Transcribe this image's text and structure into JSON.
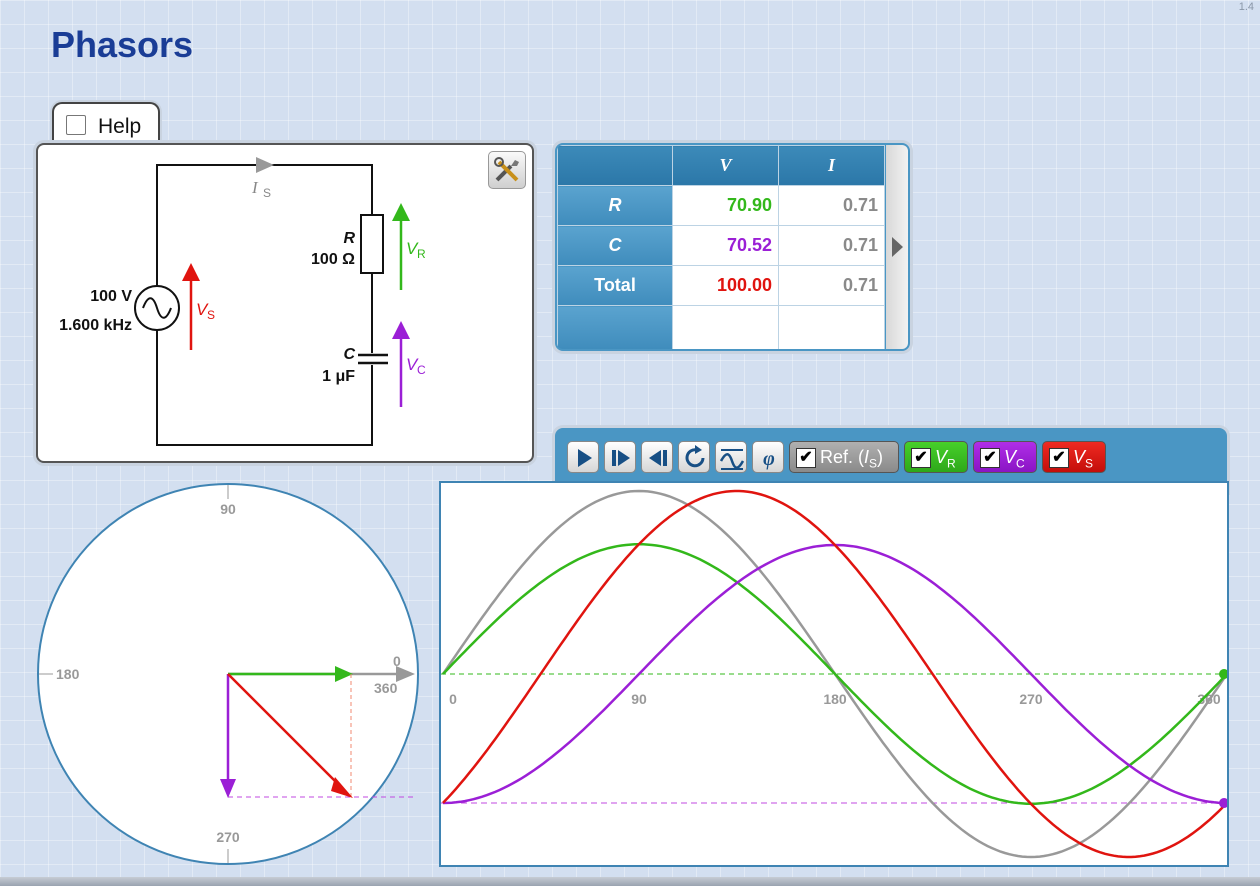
{
  "version": "1.4",
  "title": "Phasors",
  "help": {
    "label": "Help"
  },
  "circuit": {
    "source_voltage": "100 V",
    "source_frequency": "1.600 kHz",
    "current_label": "I",
    "current_sub": "S",
    "resistor_name": "R",
    "resistor_value": "100 Ω",
    "capacitor_name": "C",
    "capacitor_value": "1 μF",
    "vs_label": "V",
    "vs_sub": "S",
    "vr_label": "V",
    "vr_sub": "R",
    "vc_label": "V",
    "vc_sub": "C"
  },
  "table": {
    "headers": [
      "",
      "V",
      "I"
    ],
    "rows": [
      {
        "name": "R",
        "v": "70.90",
        "i": "0.71",
        "v_color": "#33b81b"
      },
      {
        "name": "C",
        "v": "70.52",
        "i": "0.71",
        "v_color": "#9b1fd6"
      },
      {
        "name": "Total",
        "v": "100.00",
        "i": "0.71",
        "v_color": "#e0140f"
      }
    ]
  },
  "toolbar": {
    "buttons": [
      "play-icon",
      "step-forward-icon",
      "step-back-icon",
      "reset-icon",
      "waveform-icon",
      "phi-icon"
    ],
    "ref_label": "Ref. (",
    "ref_var": "I",
    "ref_sub": "S",
    "ref_close": ")",
    "vr_label": "V",
    "vr_sub": "R",
    "vc_label": "V",
    "vc_sub": "C",
    "vs_label": "V",
    "vs_sub": "S",
    "check_mark": "✔"
  },
  "phasor_diagram": {
    "angle_labels": {
      "a90": "90",
      "a180": "180",
      "a0": "0",
      "a360": "360",
      "a270": "270"
    }
  },
  "chart_data": {
    "type": "line",
    "x_ticks": [
      "0",
      "90",
      "180",
      "270",
      "360"
    ],
    "xlim": [
      0,
      360
    ],
    "series": [
      {
        "name": "Ref. (IS)",
        "color": "#999999",
        "amplitude": 1.0,
        "phase_deg": 0
      },
      {
        "name": "VR",
        "color": "#33b81b",
        "amplitude": 0.709,
        "phase_deg": 0
      },
      {
        "name": "VC",
        "color": "#9b1fd6",
        "amplitude": 0.705,
        "phase_deg": -90
      },
      {
        "name": "VS",
        "color": "#e0140f",
        "amplitude": 1.0,
        "phase_deg": -44.8
      }
    ]
  },
  "colors": {
    "accent": "#1a3d96",
    "panel": "#4a96c4",
    "vr": "#33b81b",
    "vc": "#9b1fd6",
    "vs": "#e0140f",
    "ref": "#999999"
  }
}
